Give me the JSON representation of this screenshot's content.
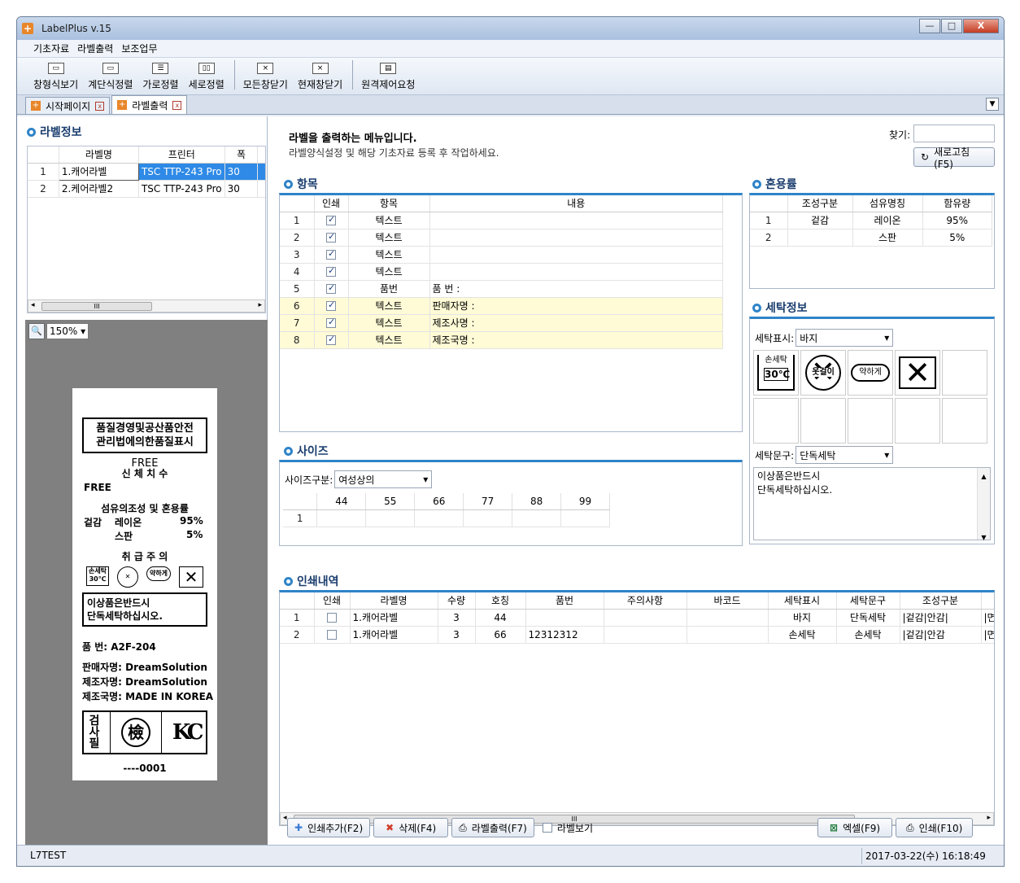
{
  "window": {
    "title": "LabelPlus v.15",
    "min": "—",
    "max": "□",
    "close": "X"
  },
  "menu": [
    "기초자료",
    "라벨출력",
    "보조업무"
  ],
  "toolbar": [
    "창형식보기",
    "계단식정렬",
    "가로정렬",
    "세로정렬",
    "모든창닫기",
    "현재창닫기",
    "원격제어요청"
  ],
  "tabs": [
    {
      "label": "시작페이지"
    },
    {
      "label": "라벨출력"
    }
  ],
  "label_info": {
    "title": "라벨정보",
    "headers": [
      "라벨명",
      "프린터",
      "폭"
    ],
    "rows": [
      {
        "no": "1",
        "name": "1.캐어라벨",
        "printer": "TSC TTP-243 Pro",
        "width": "30"
      },
      {
        "no": "2",
        "name": "2.케어라벨2",
        "printer": "TSC TTP-243 Pro",
        "width": "30"
      }
    ]
  },
  "preview": {
    "zoom": "150%",
    "label": {
      "box_title_1": "품질경영및공산품안전",
      "box_title_2": "관리법에의한품질표시",
      "size_free": "FREE",
      "size_label": "신 체 치 수",
      "size_value": "FREE",
      "fiber_title": "섬유의조성 및 혼용률",
      "fiber_rows": [
        {
          "part": "겉감",
          "name": "레이온",
          "ratio": "95%"
        },
        {
          "part": "",
          "name": "스판",
          "ratio": "5%"
        }
      ],
      "care_title": "취 급 주 의",
      "wash_box_1": "이상품은반드시",
      "wash_box_2": "단독세탁하십시오.",
      "product_no": "품      번: A2F-204",
      "seller": "판매자명: DreamSolution",
      "maker": "제조자명: DreamSolution",
      "country": "제조국명: MADE IN KOREA",
      "inspect_1": "검",
      "inspect_2": "사",
      "inspect_3": "필",
      "inspect_mark": "檢",
      "kc_mark": "KC",
      "serial": "----0001"
    }
  },
  "header": {
    "title": "라벨을 출력하는 메뉴입니다.",
    "subtitle": "라벨양식설정 및 해당 기초자료 등록 후 작업하세요.",
    "search_label": "찾기:",
    "refresh": "새로고침(F5)"
  },
  "items": {
    "title": "항목",
    "headers": [
      "인쇄",
      "항목",
      "내용"
    ],
    "rows": [
      {
        "no": "1",
        "item": "텍스트",
        "content": ""
      },
      {
        "no": "2",
        "item": "텍스트",
        "content": ""
      },
      {
        "no": "3",
        "item": "텍스트",
        "content": ""
      },
      {
        "no": "4",
        "item": "텍스트",
        "content": ""
      },
      {
        "no": "5",
        "item": "품번",
        "content": "품      번 :"
      },
      {
        "no": "6",
        "item": "텍스트",
        "content": "판매자명 :"
      },
      {
        "no": "7",
        "item": "텍스트",
        "content": "제조사명 :"
      },
      {
        "no": "8",
        "item": "텍스트",
        "content": "제조국명 :"
      }
    ]
  },
  "blend": {
    "title": "혼용률",
    "headers": [
      "조성구분",
      "섬유명칭",
      "함유량"
    ],
    "rows": [
      {
        "no": "1",
        "part": "겉감",
        "fiber": "레이온",
        "ratio": "95%"
      },
      {
        "no": "2",
        "part": "",
        "fiber": "스판",
        "ratio": "5%"
      }
    ]
  },
  "wash": {
    "title": "세탁정보",
    "display_label": "세탁표시:",
    "display_value": "바지",
    "icons": [
      {
        "name": "hand-wash-30-icon",
        "text1": "손세탁",
        "text2": "30℃"
      },
      {
        "name": "no-wring-icon",
        "text1": "옷걸이"
      },
      {
        "name": "low-iron-icon",
        "text1": "약하게"
      },
      {
        "name": "no-dryclean-icon"
      }
    ],
    "phrase_label": "세탁문구:",
    "phrase_value": "단독세탁",
    "phrase_text_1": "이상품은반드시",
    "phrase_text_2": "단독세탁하십시오."
  },
  "size": {
    "title": "사이즈",
    "type_label": "사이즈구분:",
    "type_value": "여성상의",
    "headers": [
      "44",
      "55",
      "66",
      "77",
      "88",
      "99"
    ],
    "row_no": "1"
  },
  "history": {
    "title": "인쇄내역",
    "headers": [
      "인쇄",
      "라벨명",
      "수량",
      "호칭",
      "품번",
      "주의사항",
      "바코드",
      "세탁표시",
      "세탁문구",
      "조성구분"
    ],
    "rows": [
      {
        "no": "1",
        "label": "1.캐어라벨",
        "qty": "3",
        "call": "44",
        "product": "",
        "caution": "",
        "barcode": "",
        "wash": "바지",
        "phrase": "단독세탁",
        "comp": "|겉감|안감|",
        "extra": "|면"
      },
      {
        "no": "2",
        "label": "1.캐어라벨",
        "qty": "3",
        "call": "66",
        "product": "12312312",
        "caution": "",
        "barcode": "",
        "wash": "손세탁",
        "phrase": "손세탁",
        "comp": "|겉감|안감",
        "extra": "|면"
      }
    ]
  },
  "actions": {
    "add": "인쇄추가(F2)",
    "delete": "삭제(F4)",
    "print_label": "라벨출력(F7)",
    "view_label": "라벨보기",
    "excel": "엑셀(F9)",
    "print": "인쇄(F10)"
  },
  "status": {
    "left": "L7TEST",
    "right": "2017-03-22(수) 16:18:49"
  }
}
